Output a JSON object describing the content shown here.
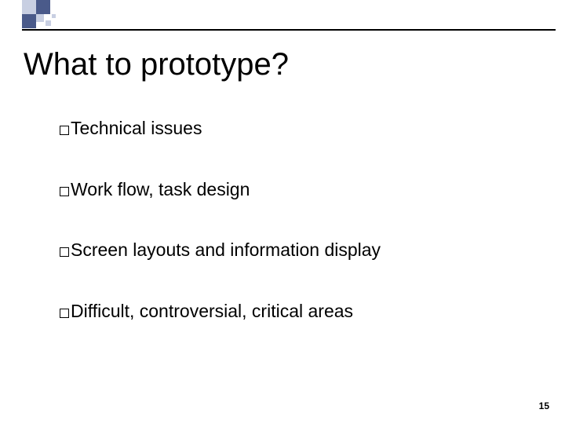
{
  "title": "What to prototype?",
  "bullets": {
    "b1": "Technical issues",
    "b2": "Work flow, task design",
    "b3": "Screen layouts and information display",
    "b4": "Difficult, controversial, critical areas"
  },
  "page_number": "15"
}
